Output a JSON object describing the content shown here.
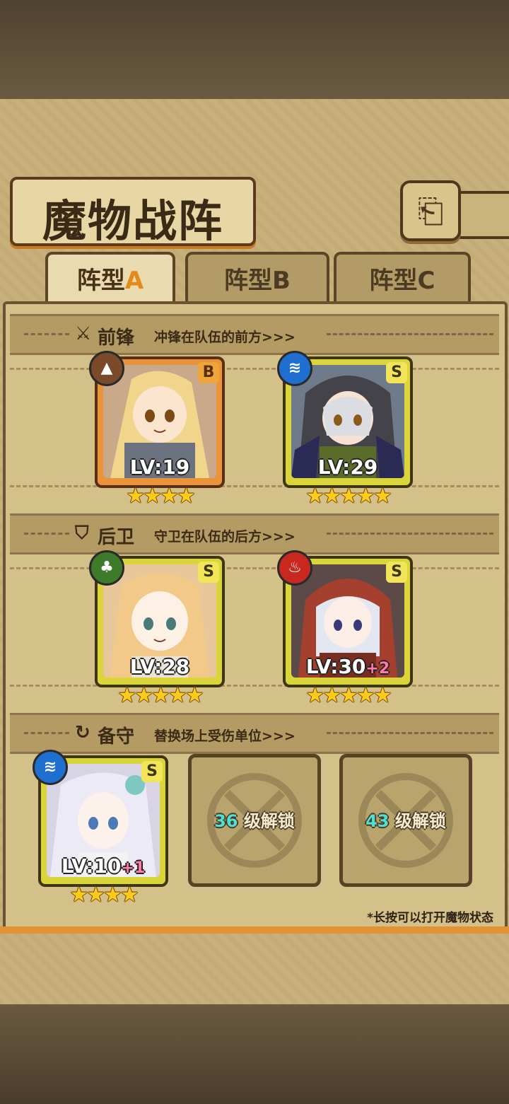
{
  "title": "魔物战阵",
  "back_icon": "back-arrow-icon",
  "tabs": [
    {
      "label": "阵型",
      "letter": "A",
      "active": true
    },
    {
      "label": "阵型",
      "letter": "B",
      "active": false
    },
    {
      "label": "阵型",
      "letter": "C",
      "active": false
    }
  ],
  "sections": {
    "front": {
      "icon": "sword-icon",
      "title": "前锋",
      "desc": "冲锋在队伍的前方>>>"
    },
    "rear": {
      "icon": "shield-icon",
      "title": "后卫",
      "desc": "守卫在队伍的后方>>>"
    },
    "reserve": {
      "icon": "swap-icon",
      "title": "备守",
      "desc": "替换场上受伤单位>>>"
    }
  },
  "monsters": {
    "front1": {
      "element": "earth",
      "element_glyph": "▲",
      "element_color": "#7a4a2a",
      "grade": "B",
      "level": "LV:19",
      "bonus": "",
      "stars": "★★★★"
    },
    "front2": {
      "element": "water",
      "element_glyph": "≋",
      "element_color": "#1f6fd1",
      "grade": "S",
      "level": "LV:29",
      "bonus": "",
      "stars": "★★★★★"
    },
    "rear1": {
      "element": "wood",
      "element_glyph": "♣",
      "element_color": "#3d7a2a",
      "grade": "S",
      "level": "LV:28",
      "bonus": "",
      "stars": "★★★★★"
    },
    "rear2": {
      "element": "fire",
      "element_glyph": "♨",
      "element_color": "#c8281e",
      "grade": "S",
      "level": "LV:30",
      "bonus": "+2",
      "stars": "★★★★★"
    },
    "reserve1": {
      "element": "water",
      "element_glyph": "≋",
      "element_color": "#1f6fd1",
      "grade": "S",
      "level": "LV:10",
      "bonus": "+1",
      "stars": "★★★★"
    }
  },
  "locked_slots": [
    {
      "level": "36",
      "text": "级解锁"
    },
    {
      "level": "43",
      "text": "级解锁"
    }
  ],
  "footnote": "*长按可以打开魔物状态"
}
